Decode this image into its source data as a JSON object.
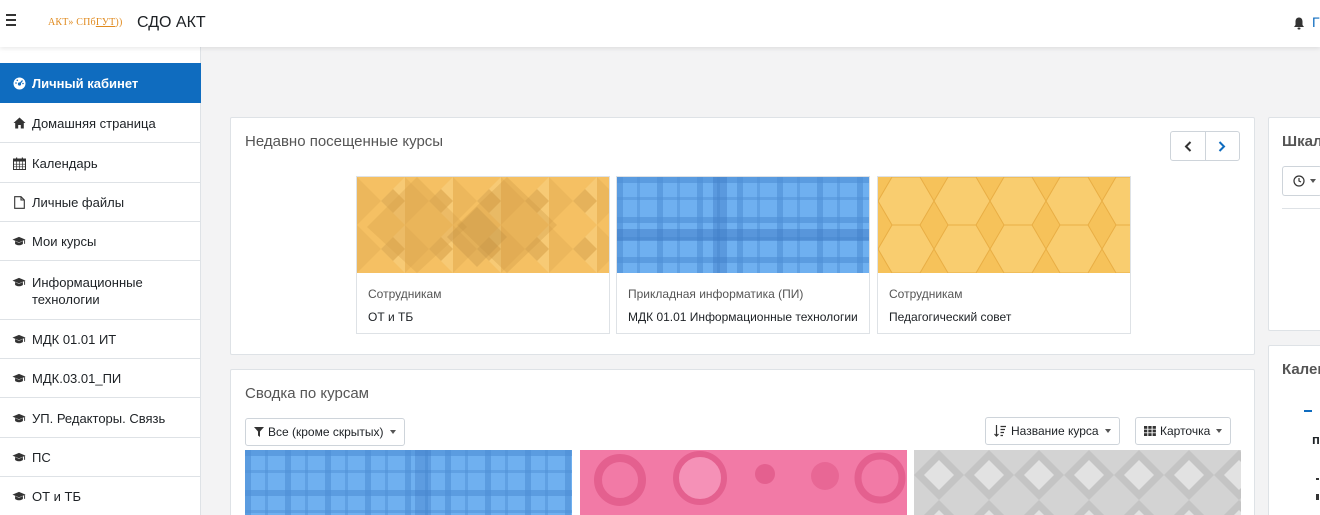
{
  "navbar": {
    "logo_text_1": "АКТ",
    "logo_text_2": "СПб",
    "logo_text_3": "ГУТ",
    "site_name": "СДО АКТ",
    "user_initial": "Г"
  },
  "sidebar": {
    "items": [
      {
        "label": "Личный кабинет",
        "icon": "dashboard-icon",
        "active": true
      },
      {
        "label": "Домашняя страница",
        "icon": "home-icon"
      },
      {
        "label": "Календарь",
        "icon": "calendar-icon"
      },
      {
        "label": "Личные файлы",
        "icon": "file-icon"
      },
      {
        "label": "Мои курсы",
        "icon": "graduation-cap-icon"
      },
      {
        "label": "Информационные технологии",
        "icon": "graduation-cap-icon"
      },
      {
        "label": "МДК 01.01 ИТ",
        "icon": "graduation-cap-icon"
      },
      {
        "label": "МДК.03.01_ПИ",
        "icon": "graduation-cap-icon"
      },
      {
        "label": "УП. Редакторы. Связь",
        "icon": "graduation-cap-icon"
      },
      {
        "label": "ПС",
        "icon": "graduation-cap-icon"
      },
      {
        "label": "ОТ и ТБ",
        "icon": "graduation-cap-icon"
      }
    ]
  },
  "recent": {
    "title": "Недавно посещенные курсы",
    "courses": [
      {
        "category": "Сотрудникам",
        "name": "ОТ и ТБ",
        "pattern": "diamond-orange"
      },
      {
        "category": "Прикладная информатика (ПИ)",
        "name": "МДК 01.01 Информационные технологии",
        "pattern": "plaid-blue"
      },
      {
        "category": "Сотрудникам",
        "name": "Педагогический совет",
        "pattern": "hexagon-orange"
      }
    ]
  },
  "overview": {
    "title": "Сводка по курсам",
    "filter_label": "Все (кроме скрытых)",
    "sort_label": "Название курса",
    "view_label": "Карточка"
  },
  "right": {
    "timeline_title": "Шкал",
    "calendar_title": "Кален",
    "calendar_initial": "п"
  },
  "colors": {
    "accent": "#0f6cbf",
    "orange": "#f5b94f",
    "blue": "#64a7ed",
    "pink": "#f07aa8",
    "grey": "#cfcfcf"
  }
}
